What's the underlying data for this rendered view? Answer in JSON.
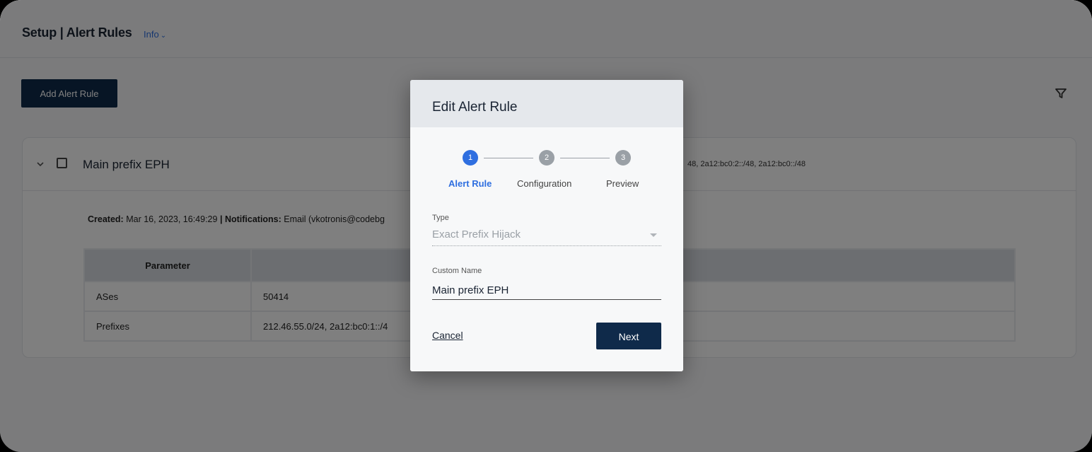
{
  "header": {
    "title": "Setup | Alert Rules",
    "info_label": "Info"
  },
  "toolbar": {
    "add_label": "Add Alert Rule",
    "filter_icon": "filter-icon"
  },
  "rule": {
    "name": "Main prefix EPH",
    "prefix_summary": "48, 2a12:bc0:2::/48, 2a12:bc0::/48",
    "created_label": "Created:",
    "created_value": "Mar 16, 2023, 16:49:29",
    "separator": "|",
    "notifications_label": "Notifications:",
    "notifications_value": "Email (vkotronis@codebg",
    "table": {
      "headers": [
        "Parameter",
        ""
      ],
      "rows": [
        [
          "ASes",
          "50414"
        ],
        [
          "Prefixes",
          "212.46.55.0/24, 2a12:bc0:1::/4"
        ]
      ]
    }
  },
  "modal": {
    "title": "Edit Alert Rule",
    "steps": [
      {
        "number": "1",
        "label": "Alert Rule",
        "state": "active"
      },
      {
        "number": "2",
        "label": "Configuration",
        "state": "inactive"
      },
      {
        "number": "3",
        "label": "Preview",
        "state": "inactive"
      }
    ],
    "type_label": "Type",
    "type_value": "Exact Prefix Hijack",
    "custom_name_label": "Custom Name",
    "custom_name_value": "Main prefix EPH",
    "cancel_label": "Cancel",
    "next_label": "Next"
  },
  "colors": {
    "primary_dark": "#0f2a4a",
    "accent_blue": "#2f6fe0",
    "step_inactive": "#9aa0a6"
  }
}
